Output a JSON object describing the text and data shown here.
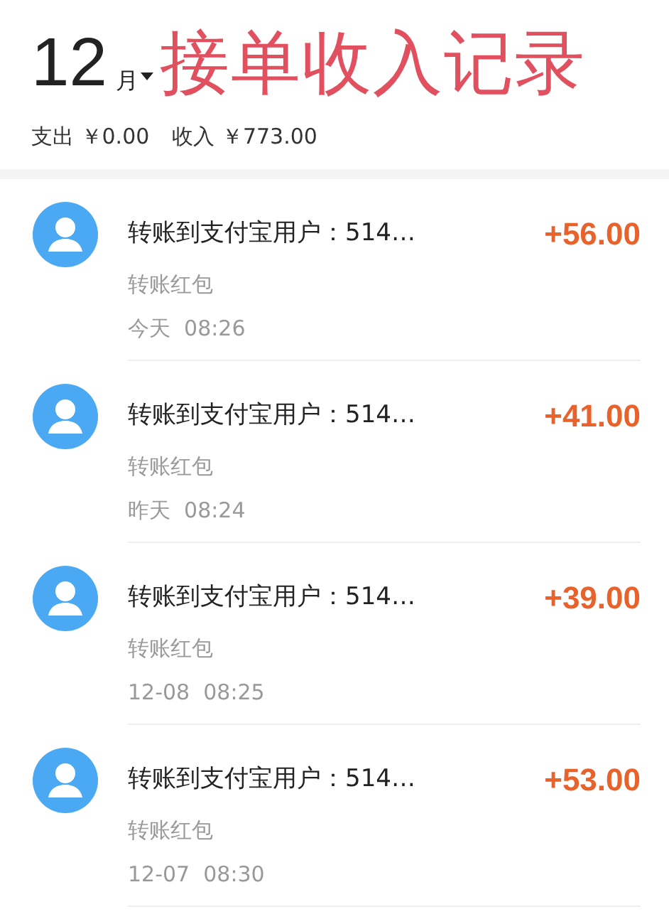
{
  "header": {
    "month": "12",
    "month_unit": "月",
    "title": "接单收入记录",
    "expense_label": "支出",
    "expense": "￥0.00",
    "income_label": "收入",
    "income": "￥773.00"
  },
  "records": [
    {
      "title": "转账到支付宝用户：514…",
      "amount": "+56.00",
      "subtitle": "转账红包",
      "day": "今天",
      "time": "08:26"
    },
    {
      "title": "转账到支付宝用户：514…",
      "amount": "+41.00",
      "subtitle": "转账红包",
      "day": "昨天",
      "time": "08:24"
    },
    {
      "title": "转账到支付宝用户：514…",
      "amount": "+39.00",
      "subtitle": "转账红包",
      "day": "12-08",
      "time": "08:25"
    },
    {
      "title": "转账到支付宝用户：514…",
      "amount": "+53.00",
      "subtitle": "转账红包",
      "day": "12-07",
      "time": "08:30"
    }
  ]
}
